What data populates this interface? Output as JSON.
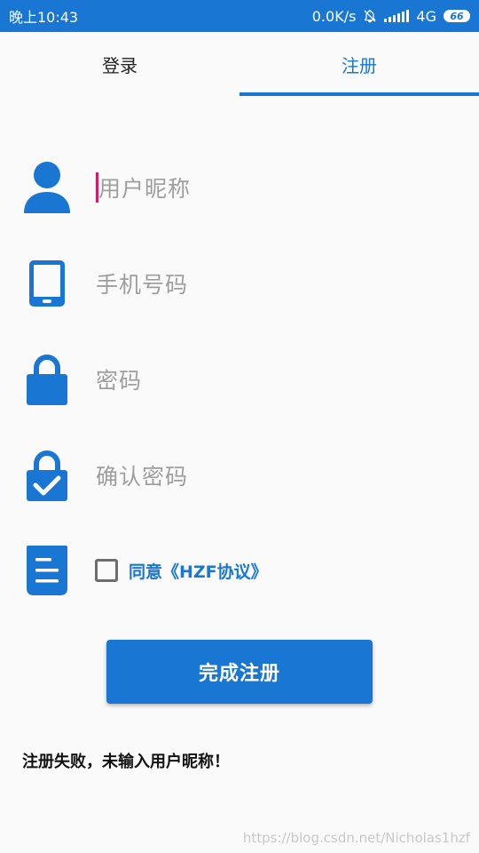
{
  "status_bar": {
    "time": "晚上10:43",
    "net_speed": "0.0K/s",
    "network": "4G",
    "battery": "66",
    "bg_color": "#1976d2"
  },
  "tabs": [
    {
      "label": "登录",
      "active": false
    },
    {
      "label": "注册",
      "active": true
    }
  ],
  "form": {
    "nickname_placeholder": "用户昵称",
    "phone_placeholder": "手机号码",
    "password_placeholder": "密码",
    "confirm_placeholder": "确认密码",
    "agreement_label": "同意《HZF协议》",
    "agreement_checked": false
  },
  "icons": {
    "nickname": "user-icon",
    "phone": "phone-icon",
    "password": "lock-icon",
    "confirm": "lock-check-icon",
    "agreement": "document-icon"
  },
  "submit_label": "完成注册",
  "error_message": "注册失败，未输入用户昵称！",
  "watermark": "https://blog.csdn.net/Nicholas1hzf",
  "colors": {
    "accent": "#1976d2",
    "cursor": "#d81b60",
    "placeholder": "#9e9e9e"
  }
}
